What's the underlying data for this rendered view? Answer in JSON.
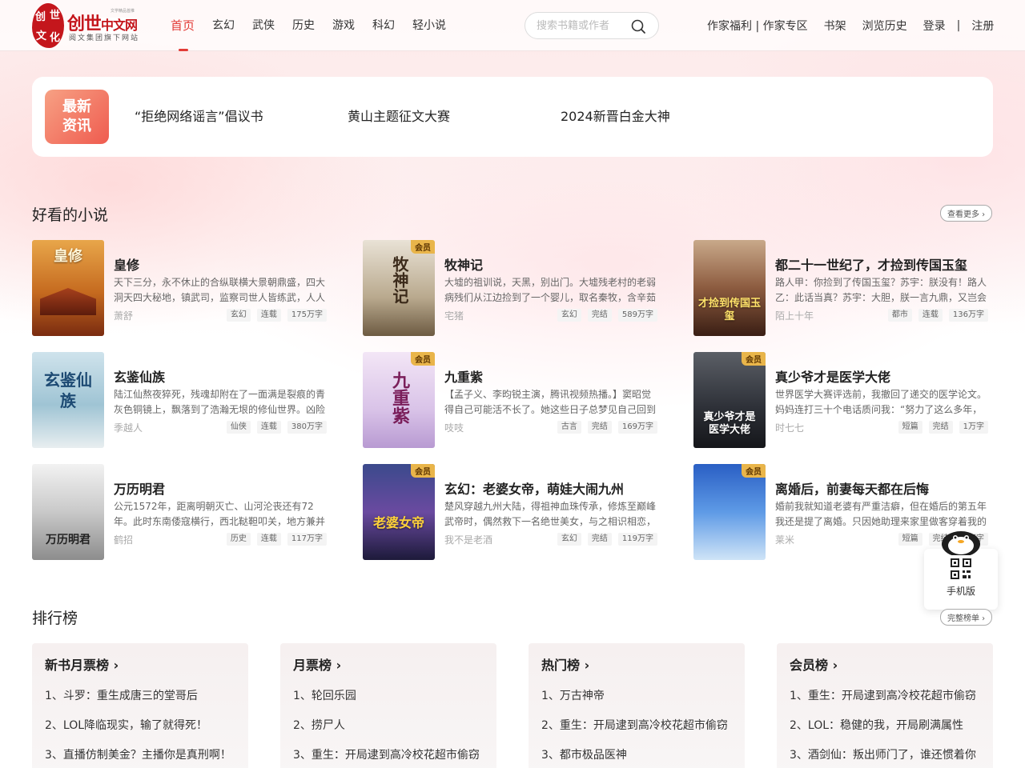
{
  "header": {
    "logo_badge": [
      "创",
      "世",
      "文",
      "化"
    ],
    "logo_main": "创世",
    "logo_main_suffix": "中文网",
    "logo_sub": "阅文集团旗下网站",
    "logo_tiny": "文学精品首推",
    "nav": [
      "首页",
      "玄幻",
      "武侠",
      "历史",
      "游戏",
      "科幻",
      "轻小说"
    ],
    "nav_active": "首页",
    "search_placeholder": "搜索书籍或作者",
    "links": {
      "author_welfare": "作家福利 | 作家专区",
      "bookshelf": "书架",
      "history": "浏览历史",
      "login": "登录",
      "separator": "|",
      "register": "注册"
    }
  },
  "news": {
    "badge_line1": "最新",
    "badge_line2": "资讯",
    "items": [
      "“拒绝网络谣言”倡议书",
      "黄山主题征文大赛",
      "2024新晋白金大神"
    ]
  },
  "novels": {
    "title": "好看的小说",
    "more": "查看更多",
    "books": [
      {
        "title": "皇修",
        "desc": "天下三分，永不休止的合纵联横大景朝鼎盛，四大洞天四大秘地，镇武司，监察司世人皆练武，人人如龙",
        "author": "萧舒",
        "tags": [
          "玄幻",
          "连载",
          "175万字"
        ],
        "vip": "",
        "cover_text": "皇修"
      },
      {
        "title": "牧神记",
        "desc": "大墟的祖训说，天黑，别出门。大墟残老村的老弱病残们从江边捡到了一个婴儿，取名秦牧，含辛茹苦",
        "author": "宅猪",
        "tags": [
          "玄幻",
          "完结",
          "589万字"
        ],
        "vip": "会员",
        "cover_text": "牧神记"
      },
      {
        "title": "都二十一世纪了，才捡到传国玉玺",
        "desc": "路人甲：你捡到了传国玉玺？苏宇：朕没有！路人乙：此话当真？苏宇：大胆，朕一言九鼎，又岂会骗你",
        "author": "陌上十年",
        "tags": [
          "都市",
          "连载",
          "136万字"
        ],
        "vip": "",
        "cover_text": "才捡到传国玉玺"
      },
      {
        "title": "玄鉴仙族",
        "desc": "陆江仙熬夜猝死，残魂却附在了一面满是裂痕的青灰色铜镜上，飘落到了浩瀚无垠的修仙世界。凶险万分",
        "author": "季越人",
        "tags": [
          "仙侠",
          "连载",
          "380万字"
        ],
        "vip": "",
        "cover_text": "玄鉴仙族"
      },
      {
        "title": "九重紫",
        "desc": "【孟子义、李昀锐主演，腾讯视频热播。】窦昭觉得自己可能活不长了。她这些日子总梦见自己回到了从前",
        "author": "吱吱",
        "tags": [
          "古言",
          "完结",
          "169万字"
        ],
        "vip": "会员",
        "cover_text": "九重紫"
      },
      {
        "title": "真少爷才是医学大佬",
        "desc": "世界医学大赛评选前，我撤回了递交的医学论文。妈妈连打三十个电话质问我：“努力了这么多年，你就甘心",
        "author": "时七七",
        "tags": [
          "短篇",
          "完结",
          "1万字"
        ],
        "vip": "会员",
        "cover_text": "真少爷才是医学大佬"
      },
      {
        "title": "万历明君",
        "desc": "公元1572年，距离明朝灭亡、山河沦丧还有72年。此时东南倭寇横行，西北鞑靼叩关，地方兼并成风",
        "author": "鹤招",
        "tags": [
          "历史",
          "连载",
          "117万字"
        ],
        "vip": "",
        "cover_text": "万历明君"
      },
      {
        "title": "玄幻：老婆女帝，萌娃大闹九州",
        "desc": "楚风穿越九州大陆，得祖神血珠传承，修炼至巅峰武帝时，偶然救下一名绝世美女，与之相识相恋，生下",
        "author": "我不是老酒",
        "tags": [
          "玄幻",
          "完结",
          "119万字"
        ],
        "vip": "会员",
        "cover_text": "老婆女帝"
      },
      {
        "title": "离婚后，前妻每天都在后悔",
        "desc": "婚前我就知道老婆有严重洁癖，但在婚后的第五年我还是提了离婚。只因她助理来家里做客穿着我的睡衣",
        "author": "莱米",
        "tags": [
          "短篇",
          "完结",
          "2万字"
        ],
        "vip": "会员",
        "cover_text": ""
      }
    ]
  },
  "mobile": {
    "label": "手机版"
  },
  "ranking": {
    "title": "排行榜",
    "more": "完整榜单",
    "boards": [
      {
        "name": "新书月票榜",
        "items": [
          "1、斗罗：重生成唐三的堂哥后",
          "2、LOL降临现实，输了就得死！",
          "3、直播仿制美金？主播你是真刑啊！"
        ]
      },
      {
        "name": "月票榜",
        "items": [
          "1、轮回乐园",
          "2、捞尸人",
          "3、重生：开局逮到高冷校花超市偷窃"
        ]
      },
      {
        "name": "热门榜",
        "items": [
          "1、万古神帝",
          "2、重生：开局逮到高冷校花超市偷窃",
          "3、都市极品医神"
        ]
      },
      {
        "name": "会员榜",
        "items": [
          "1、重生：开局逮到高冷校花超市偷窃",
          "2、LOL：稳健的我，开局刷满属性",
          "3、酒剑仙：叛出师门了，谁还惯着你"
        ]
      }
    ]
  },
  "colors": {
    "accent": "#e23b36",
    "brand": "#c4161c",
    "vip": "#e9b54a"
  }
}
